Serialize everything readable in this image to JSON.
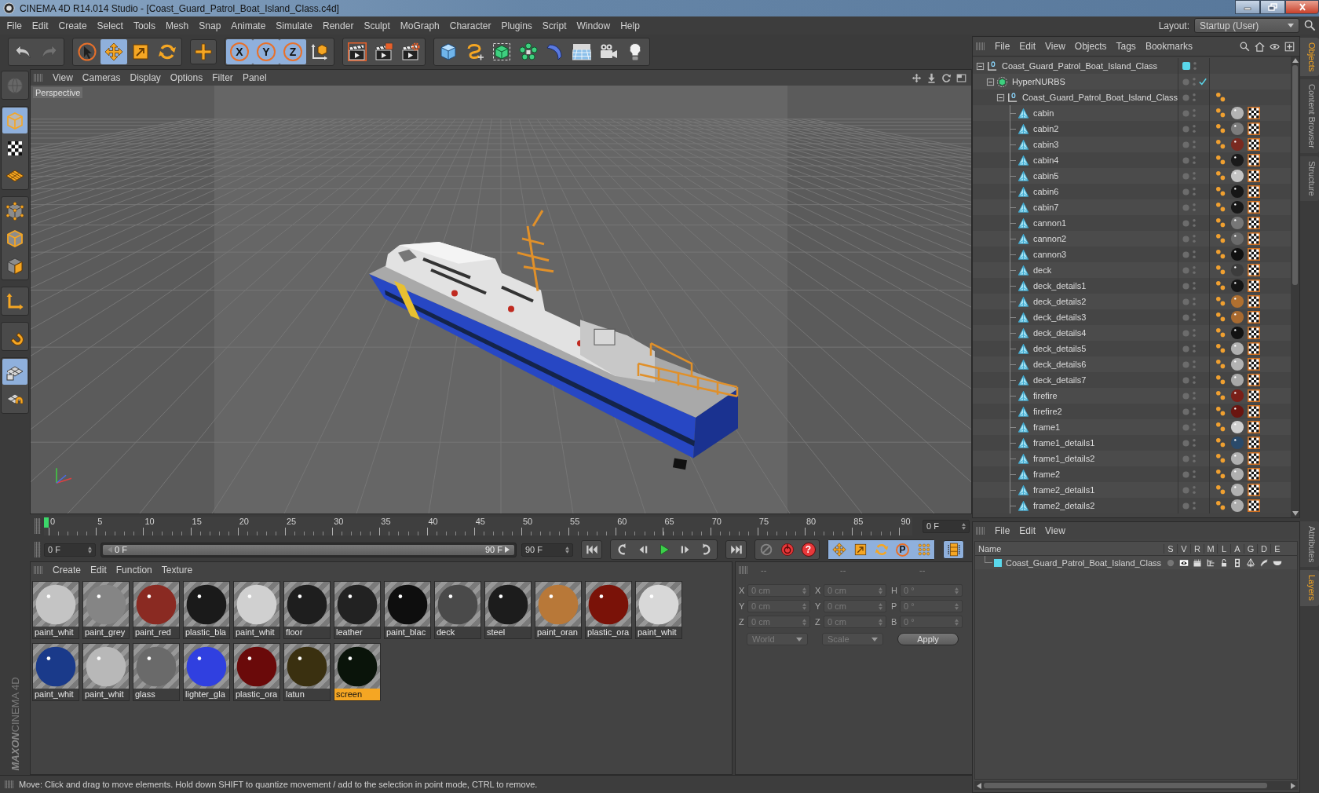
{
  "window": {
    "title": "CINEMA 4D R14.014 Studio - [Coast_Guard_Patrol_Boat_Island_Class.c4d]"
  },
  "menu": [
    "File",
    "Edit",
    "Create",
    "Select",
    "Tools",
    "Mesh",
    "Snap",
    "Animate",
    "Simulate",
    "Render",
    "Sculpt",
    "MoGraph",
    "Character",
    "Plugins",
    "Script",
    "Window",
    "Help"
  ],
  "layout": {
    "label": "Layout:",
    "value": "Startup (User)"
  },
  "toolbar": [
    [
      {
        "kind": "undo",
        "disabled": false
      },
      {
        "kind": "redo",
        "disabled": true
      }
    ],
    [
      {
        "kind": "live-selection",
        "selected": false
      },
      {
        "kind": "move",
        "selected": true
      },
      {
        "kind": "scale",
        "selected": false
      },
      {
        "kind": "rotate",
        "selected": false
      }
    ],
    [
      {
        "kind": "last-tool",
        "selected": false
      }
    ],
    [
      {
        "kind": "axis",
        "label": "X",
        "selected": true
      },
      {
        "kind": "axis",
        "label": "Y",
        "selected": true
      },
      {
        "kind": "axis",
        "label": "Z",
        "selected": true
      },
      {
        "kind": "coordinate-system",
        "selected": false
      }
    ],
    [
      {
        "kind": "render-view"
      },
      {
        "kind": "render-picture"
      },
      {
        "kind": "render-settings"
      }
    ],
    [
      {
        "kind": "cube"
      },
      {
        "kind": "spline-pen"
      },
      {
        "kind": "subdivision"
      },
      {
        "kind": "cloner"
      },
      {
        "kind": "bend"
      },
      {
        "kind": "floor"
      },
      {
        "kind": "camera"
      },
      {
        "kind": "light"
      }
    ]
  ],
  "tools": [
    [
      {
        "kind": "make-editable",
        "selected": false,
        "disabled": true
      }
    ],
    [
      {
        "kind": "model",
        "selected": true
      },
      {
        "kind": "texture",
        "selected": false
      },
      {
        "kind": "workplane",
        "selected": false
      }
    ],
    [
      {
        "kind": "points",
        "selected": false
      },
      {
        "kind": "edges",
        "selected": false
      },
      {
        "kind": "polygons",
        "selected": false
      }
    ],
    [
      {
        "kind": "axis-mode",
        "selected": false
      }
    ],
    [
      {
        "kind": "tweak",
        "selected": false
      }
    ],
    [
      {
        "kind": "workplane-lock",
        "selected": true
      },
      {
        "kind": "snap",
        "selected": false
      }
    ]
  ],
  "logo": {
    "brand": "MAXON",
    "product": "CINEMA 4D"
  },
  "viewport": {
    "menu": [
      "View",
      "Cameras",
      "Display",
      "Options",
      "Filter",
      "Panel"
    ],
    "camera": "Perspective"
  },
  "objects": {
    "menu": [
      "File",
      "Edit",
      "View",
      "Objects",
      "Tags",
      "Bookmarks"
    ],
    "tree": [
      {
        "name": "Coast_Guard_Patrol_Boat_Island_Class",
        "kind": "null",
        "color": "#5ad8ec",
        "expanded": true,
        "children": [
          {
            "name": "HyperNURBS",
            "kind": "subdivision",
            "enabled": true,
            "expanded": true,
            "children": [
              {
                "name": "Coast_Guard_Patrol_Boat_Island_Class",
                "kind": "null",
                "expanded": true,
                "tags": [
                  {
                    "kind": "phong"
                  }
                ],
                "children": [
                  {
                    "name": "cabin",
                    "kind": "polygon",
                    "tags": [
                      {
                        "kind": "phong"
                      },
                      {
                        "kind": "material",
                        "color": "#b4b4b4"
                      },
                      {
                        "kind": "texture"
                      }
                    ]
                  },
                  {
                    "name": "cabin2",
                    "kind": "polygon",
                    "tags": [
                      {
                        "kind": "phong"
                      },
                      {
                        "kind": "material",
                        "color": "#7c7c7c"
                      },
                      {
                        "kind": "texture"
                      }
                    ]
                  },
                  {
                    "name": "cabin3",
                    "kind": "polygon",
                    "tags": [
                      {
                        "kind": "phong"
                      },
                      {
                        "kind": "material",
                        "color": "#7a2a20"
                      },
                      {
                        "kind": "texture"
                      }
                    ]
                  },
                  {
                    "name": "cabin4",
                    "kind": "polygon",
                    "tags": [
                      {
                        "kind": "phong"
                      },
                      {
                        "kind": "material",
                        "color": "#1a1a1a"
                      },
                      {
                        "kind": "texture"
                      }
                    ]
                  },
                  {
                    "name": "cabin5",
                    "kind": "polygon",
                    "tags": [
                      {
                        "kind": "phong"
                      },
                      {
                        "kind": "material",
                        "color": "#c4c4c4"
                      },
                      {
                        "kind": "texture"
                      }
                    ]
                  },
                  {
                    "name": "cabin6",
                    "kind": "polygon",
                    "tags": [
                      {
                        "kind": "phong"
                      },
                      {
                        "kind": "material",
                        "color": "#161616"
                      },
                      {
                        "kind": "texture"
                      }
                    ]
                  },
                  {
                    "name": "cabin7",
                    "kind": "polygon",
                    "tags": [
                      {
                        "kind": "phong"
                      },
                      {
                        "kind": "material",
                        "color": "#181818"
                      },
                      {
                        "kind": "texture"
                      }
                    ]
                  },
                  {
                    "name": "cannon1",
                    "kind": "polygon",
                    "tags": [
                      {
                        "kind": "phong"
                      },
                      {
                        "kind": "material",
                        "color": "#777777"
                      },
                      {
                        "kind": "texture"
                      }
                    ]
                  },
                  {
                    "name": "cannon2",
                    "kind": "polygon",
                    "tags": [
                      {
                        "kind": "phong"
                      },
                      {
                        "kind": "material",
                        "color": "#6a6a6a"
                      },
                      {
                        "kind": "texture"
                      }
                    ]
                  },
                  {
                    "name": "cannon3",
                    "kind": "polygon",
                    "tags": [
                      {
                        "kind": "phong"
                      },
                      {
                        "kind": "material",
                        "color": "#111111"
                      },
                      {
                        "kind": "texture"
                      }
                    ]
                  },
                  {
                    "name": "deck",
                    "kind": "polygon",
                    "tags": [
                      {
                        "kind": "phong"
                      },
                      {
                        "kind": "material",
                        "color": "#3c3c3c"
                      },
                      {
                        "kind": "texture"
                      }
                    ]
                  },
                  {
                    "name": "deck_details1",
                    "kind": "polygon",
                    "tags": [
                      {
                        "kind": "phong"
                      },
                      {
                        "kind": "material",
                        "color": "#151515"
                      },
                      {
                        "kind": "texture"
                      }
                    ]
                  },
                  {
                    "name": "deck_details2",
                    "kind": "polygon",
                    "tags": [
                      {
                        "kind": "phong"
                      },
                      {
                        "kind": "material",
                        "color": "#b07030"
                      },
                      {
                        "kind": "texture"
                      }
                    ]
                  },
                  {
                    "name": "deck_details3",
                    "kind": "polygon",
                    "tags": [
                      {
                        "kind": "phong"
                      },
                      {
                        "kind": "material",
                        "color": "#a86a30"
                      },
                      {
                        "kind": "texture"
                      }
                    ]
                  },
                  {
                    "name": "deck_details4",
                    "kind": "polygon",
                    "tags": [
                      {
                        "kind": "phong"
                      },
                      {
                        "kind": "material",
                        "color": "#121212"
                      },
                      {
                        "kind": "texture"
                      }
                    ]
                  },
                  {
                    "name": "deck_details5",
                    "kind": "polygon",
                    "tags": [
                      {
                        "kind": "phong"
                      },
                      {
                        "kind": "material",
                        "color": "#b0b0b0"
                      },
                      {
                        "kind": "texture"
                      }
                    ]
                  },
                  {
                    "name": "deck_details6",
                    "kind": "polygon",
                    "tags": [
                      {
                        "kind": "phong"
                      },
                      {
                        "kind": "material",
                        "color": "#b2b2b2"
                      },
                      {
                        "kind": "texture"
                      }
                    ]
                  },
                  {
                    "name": "deck_details7",
                    "kind": "polygon",
                    "tags": [
                      {
                        "kind": "phong"
                      },
                      {
                        "kind": "material",
                        "color": "#a8a8a8"
                      },
                      {
                        "kind": "texture"
                      }
                    ]
                  },
                  {
                    "name": "firefire",
                    "kind": "polygon",
                    "tags": [
                      {
                        "kind": "phong"
                      },
                      {
                        "kind": "material",
                        "color": "#7a1f18"
                      },
                      {
                        "kind": "texture"
                      }
                    ]
                  },
                  {
                    "name": "firefire2",
                    "kind": "polygon",
                    "tags": [
                      {
                        "kind": "phong"
                      },
                      {
                        "kind": "material",
                        "color": "#6a1510"
                      },
                      {
                        "kind": "texture"
                      }
                    ]
                  },
                  {
                    "name": "frame1",
                    "kind": "polygon",
                    "tags": [
                      {
                        "kind": "phong"
                      },
                      {
                        "kind": "material",
                        "color": "#cfcfcf"
                      },
                      {
                        "kind": "texture"
                      }
                    ]
                  },
                  {
                    "name": "frame1_details1",
                    "kind": "polygon",
                    "tags": [
                      {
                        "kind": "phong"
                      },
                      {
                        "kind": "material",
                        "color": "#2a4a6a"
                      },
                      {
                        "kind": "texture"
                      }
                    ]
                  },
                  {
                    "name": "frame1_details2",
                    "kind": "polygon",
                    "tags": [
                      {
                        "kind": "phong"
                      },
                      {
                        "kind": "material",
                        "color": "#b0b0b0"
                      },
                      {
                        "kind": "texture"
                      }
                    ]
                  },
                  {
                    "name": "frame2",
                    "kind": "polygon",
                    "tags": [
                      {
                        "kind": "phong"
                      },
                      {
                        "kind": "material",
                        "color": "#afafaf"
                      },
                      {
                        "kind": "texture"
                      }
                    ]
                  },
                  {
                    "name": "frame2_details1",
                    "kind": "polygon",
                    "tags": [
                      {
                        "kind": "phong"
                      },
                      {
                        "kind": "material",
                        "color": "#b1b1b1"
                      },
                      {
                        "kind": "texture"
                      }
                    ]
                  },
                  {
                    "name": "frame2_details2",
                    "kind": "polygon",
                    "tags": [
                      {
                        "kind": "phong"
                      },
                      {
                        "kind": "material",
                        "color": "#adadad"
                      },
                      {
                        "kind": "texture"
                      }
                    ]
                  }
                ]
              }
            ]
          }
        ]
      }
    ]
  },
  "object_tabs": [
    {
      "label": "Objects",
      "selected": true
    },
    {
      "label": "Content Browser",
      "selected": false
    },
    {
      "label": "Structure",
      "selected": false
    }
  ],
  "timeline": {
    "ticks": [
      "0",
      "5",
      "10",
      "15",
      "20",
      "25",
      "30",
      "35",
      "40",
      "45",
      "50",
      "55",
      "60",
      "65",
      "70",
      "75",
      "80",
      "85",
      "90"
    ],
    "level": 0,
    "current_frame": "0 F"
  },
  "transport": {
    "start": "0 F",
    "range": {
      "start": "0 F",
      "end": "90 F",
      "level": 1
    },
    "end": "90 F",
    "buttons": [
      [
        {
          "kind": "goto-start"
        }
      ],
      [
        {
          "kind": "prev-key"
        },
        {
          "kind": "step-back"
        },
        {
          "kind": "play"
        },
        {
          "kind": "step-forward"
        },
        {
          "kind": "next-key"
        }
      ],
      [
        {
          "kind": "goto-end"
        }
      ],
      [
        {
          "kind": "record",
          "disabled": true
        },
        {
          "kind": "autokey",
          "disabled": false
        },
        {
          "kind": "help",
          "label": "?",
          "disabled": false
        }
      ],
      [
        {
          "kind": "key-move",
          "selected": true
        },
        {
          "kind": "key-scale",
          "selected": true
        },
        {
          "kind": "key-rotate",
          "selected": true
        },
        {
          "kind": "key-param",
          "label": "P",
          "selected": true
        },
        {
          "kind": "key-points",
          "selected": true
        }
      ],
      [
        {
          "kind": "timeline",
          "selected": true
        }
      ]
    ]
  },
  "materials": {
    "menu": [
      "Create",
      "Edit",
      "Function",
      "Texture"
    ],
    "items": [
      {
        "name": "paint_whit",
        "color": "#c4c4c4",
        "selected": false
      },
      {
        "name": "paint_grey",
        "color": "#858585",
        "selected": false
      },
      {
        "name": "paint_red",
        "color": "#8a2a22",
        "selected": false
      },
      {
        "name": "plastic_bla",
        "color": "#1a1a1a",
        "selected": false
      },
      {
        "name": "paint_whit",
        "color": "#d0d0d0",
        "selected": false
      },
      {
        "name": "floor",
        "color": "#1e1e1e",
        "selected": false
      },
      {
        "name": "leather",
        "color": "#222222",
        "selected": false
      },
      {
        "name": "paint_blac",
        "color": "#0e0e0e",
        "selected": false
      },
      {
        "name": "deck",
        "color": "#4a4a4a",
        "selected": false
      },
      {
        "name": "steel",
        "color": "#1c1c1c",
        "selected": false
      },
      {
        "name": "paint_oran",
        "color": "#b87838",
        "selected": false
      },
      {
        "name": "plastic_ora",
        "color": "#7a1208",
        "selected": false
      },
      {
        "name": "paint_whit",
        "color": "#d8d8d8",
        "selected": false
      },
      {
        "name": "paint_whit",
        "color": "#1a3a8a",
        "selected": false
      },
      {
        "name": "paint_whit",
        "color": "#b8b8b8",
        "selected": false
      },
      {
        "name": "glass",
        "color": "#6a6a6a",
        "selected": false
      },
      {
        "name": "lighter_gla",
        "color": "#3040e0",
        "selected": false
      },
      {
        "name": "plastic_ora",
        "color": "#6a0a0a",
        "selected": false
      },
      {
        "name": "latun",
        "color": "#3a3010",
        "selected": false
      },
      {
        "name": "screen",
        "color": "#0a140a",
        "selected": true
      }
    ]
  },
  "coordinates": {
    "headers": [
      "--",
      "--",
      "--"
    ],
    "disabled": true,
    "rows": [
      {
        "labels": [
          "X",
          "X",
          "H"
        ],
        "values": [
          "0 cm",
          "0 cm",
          "0 °"
        ]
      },
      {
        "labels": [
          "Y",
          "Y",
          "P"
        ],
        "values": [
          "0 cm",
          "0 cm",
          "0 °"
        ]
      },
      {
        "labels": [
          "Z",
          "Z",
          "B"
        ],
        "values": [
          "0 cm",
          "0 cm",
          "0 °"
        ]
      }
    ],
    "modes": [
      "World",
      "Scale"
    ],
    "apply": "Apply"
  },
  "layers": {
    "menu": [
      "File",
      "Edit",
      "View"
    ],
    "columns": [
      "Name",
      "S",
      "V",
      "R",
      "M",
      "L",
      "A",
      "G",
      "D",
      "E"
    ],
    "rows": [
      {
        "name": "Coast_Guard_Patrol_Boat_Island_Class",
        "color": "#5ad8ec",
        "flags": [
          {
            "kind": "solo",
            "on": false
          },
          {
            "kind": "view",
            "on": true
          },
          {
            "kind": "render",
            "on": true
          },
          {
            "kind": "manager",
            "on": true
          },
          {
            "kind": "locked",
            "on": false
          },
          {
            "kind": "animation",
            "on": true
          },
          {
            "kind": "generators",
            "on": true
          },
          {
            "kind": "deformers",
            "on": true
          },
          {
            "kind": "expressions",
            "on": true
          }
        ]
      }
    ]
  },
  "layer_tabs": [
    {
      "label": "Attributes",
      "selected": false
    },
    {
      "label": "Layers",
      "selected": true
    }
  ],
  "status": "Move: Click and drag to move elements. Hold down SHIFT to quantize movement / add to the selection in point mode, CTRL to remove."
}
